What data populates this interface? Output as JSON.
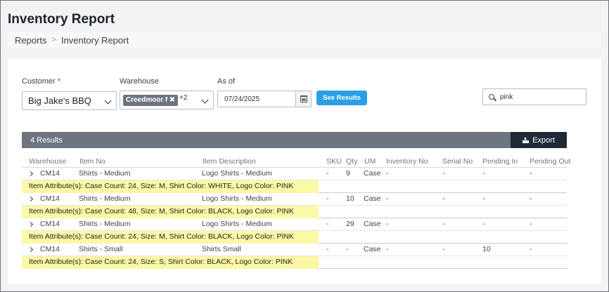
{
  "page": {
    "title": "Inventory Report"
  },
  "breadcrumb": {
    "items": [
      "Reports",
      "Inventory Report"
    ]
  },
  "filters": {
    "customer_label": "Customer",
    "customer_required": "*",
    "customer_value": "Big Jake's BBQ",
    "warehouse_label": "Warehouse",
    "warehouse_tag": "Creedmoor Mc",
    "warehouse_more": "+2",
    "asof_label": "As of",
    "asof_value": "07/24/2025",
    "see_results_label": "See Results",
    "search_value": "pink"
  },
  "results": {
    "count_label": "4 Results",
    "export_label": "Export"
  },
  "table": {
    "columns": [
      "Warehouse",
      "Item No",
      "Item Description",
      "SKU",
      "Qty",
      "UM",
      "Inventory No",
      "Serial No",
      "Pending In",
      "Pending Out"
    ],
    "rows": [
      {
        "warehouse": "CM14",
        "item_no": "Shirts - Medium",
        "description": "Logo Shirts - Medium",
        "sku": "-",
        "qty": "9",
        "um": "Case",
        "inventory_no": "-",
        "serial_no": "-",
        "pending_in": "-",
        "pending_out": "-",
        "attributes": "Item Attribute(s): Case Count: 24, Size: M, Shirt Color: WHITE, Logo Color: PINK"
      },
      {
        "warehouse": "CM14",
        "item_no": "Shirts - Medium",
        "description": "Logo Shirts - Medium",
        "sku": "-",
        "qty": "10",
        "um": "Case",
        "inventory_no": "-",
        "serial_no": "-",
        "pending_in": "-",
        "pending_out": "-",
        "attributes": "Item Attribute(s): Case Count: 48, Size: M, Shirt Color: BLACK, Logo Color: PINK"
      },
      {
        "warehouse": "CM14",
        "item_no": "Shirts - Medium",
        "description": "Logo Shirts - Medium",
        "sku": "-",
        "qty": "29",
        "um": "Case",
        "inventory_no": "-",
        "serial_no": "-",
        "pending_in": "-",
        "pending_out": "-",
        "attributes": "Item Attribute(s): Case Count: 24, Size: M, Shirt Color: BLACK, Logo Color: PINK"
      },
      {
        "warehouse": "CM14",
        "item_no": "Shirts - Small",
        "description": "Shirts Small",
        "sku": "-",
        "qty": "-",
        "um": "Case",
        "inventory_no": "-",
        "serial_no": "-",
        "pending_in": "10",
        "pending_out": "-",
        "attributes": "Item Attribute(s): Case Count: 24, Size: S, Shirt Color: BLACK, Logo Color: PINK"
      }
    ]
  },
  "colors": {
    "accent": "#2b9fe6",
    "results_bar": "#6d7680",
    "export_bg": "#1f2a36",
    "highlight": "#fbf8a6"
  }
}
